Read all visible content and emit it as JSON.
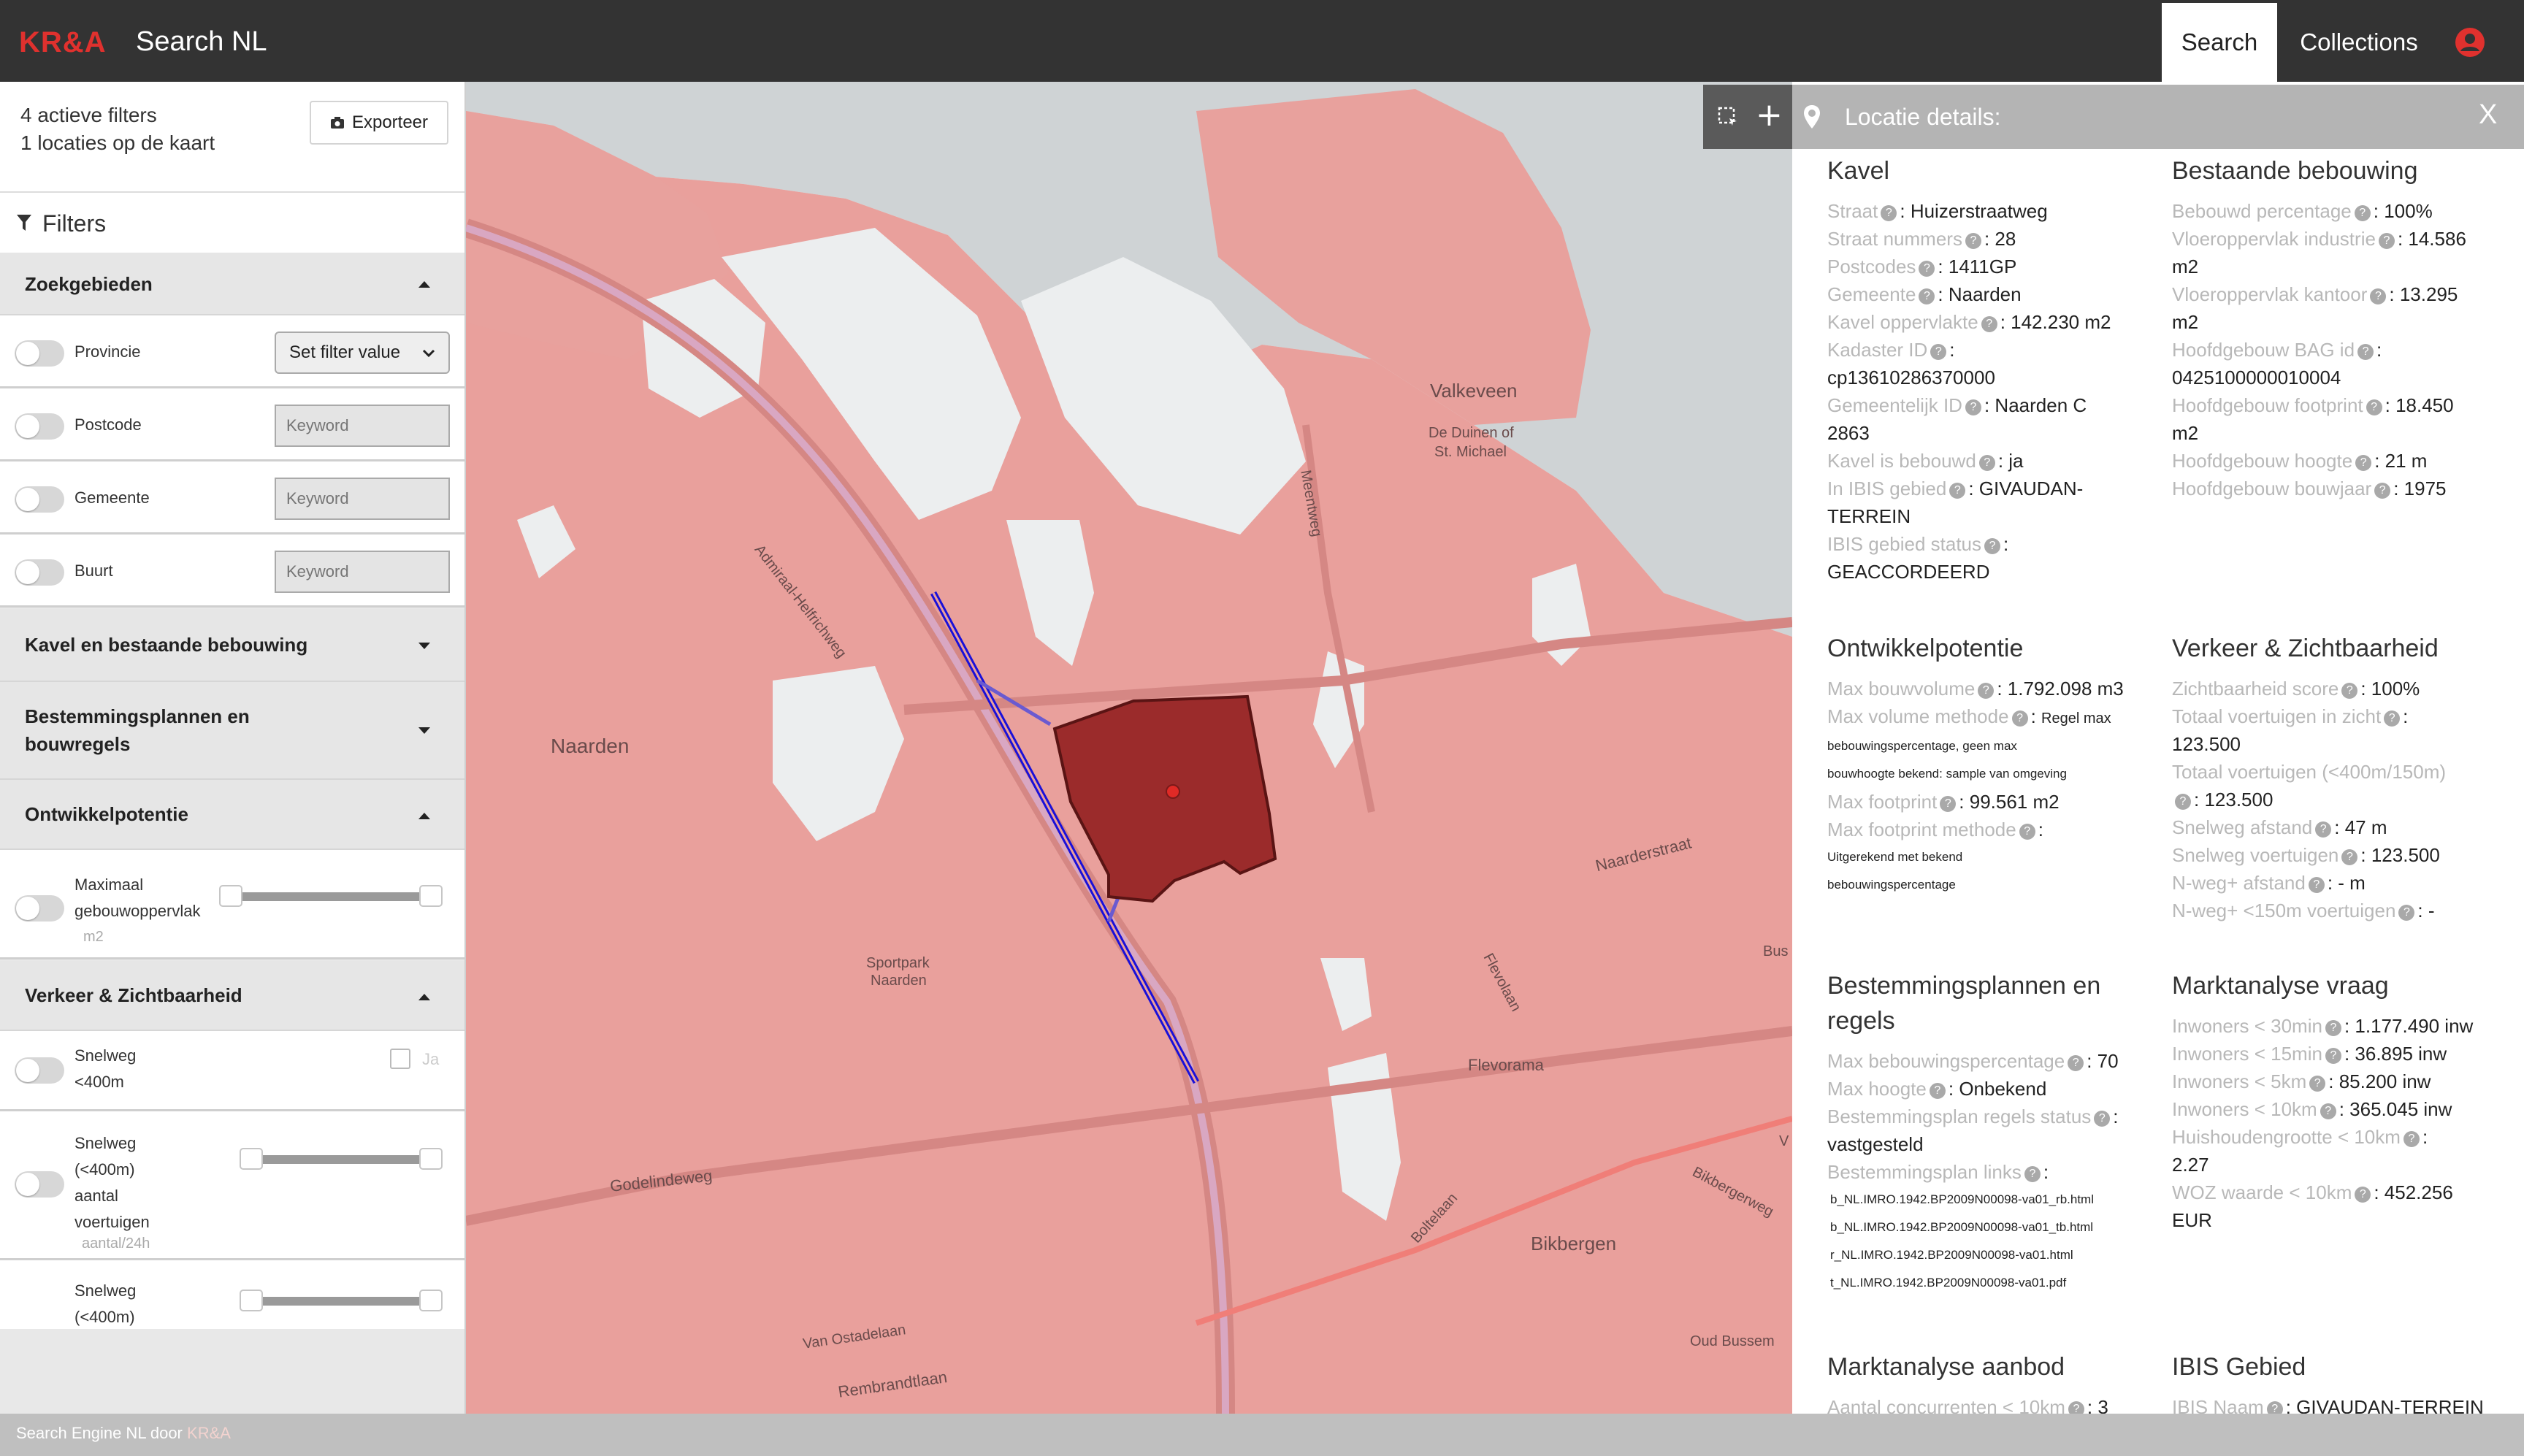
{
  "header": {
    "logo": "KR&A",
    "title": "Search NL",
    "nav": {
      "search": "Search",
      "collections": "Collections"
    }
  },
  "sidebar": {
    "active_filters": "4 actieve filters",
    "locations_on_map": "1 locaties op de kaart",
    "export_label": "Exporteer",
    "filters_title": "Filters",
    "sections": {
      "zoekgebieden": "Zoekgebieden",
      "kavel": "Kavel en bestaande bebouwing",
      "bestemming": "Bestemmingsplannen en bouwregels",
      "ontwikkel": "Ontwikkelpotentie",
      "verkeer": "Verkeer & Zichtbaarheid"
    },
    "zoek": {
      "provincie": "Provincie",
      "provincie_select": "Set filter value",
      "postcode": "Postcode",
      "gemeente": "Gemeente",
      "buurt": "Buurt",
      "keyword_placeholder": "Keyword"
    },
    "ontwikkel": {
      "label": "Maximaal gebouwoppervlak",
      "unit": "m2",
      "range": [
        0,
        1
      ]
    },
    "verkeer": {
      "snelweg": "Snelweg <400m",
      "checkbox_label": "Ja",
      "snelweg_voertuigen": "Snelweg (<400m) aantal voertuigen",
      "voertuigen_unit": "aantal/24h",
      "snelweg_partial": "Snelweg (<400m)"
    }
  },
  "map": {
    "labels": {
      "valkeveen": "Valkeveen",
      "duinen": "De Duinen of",
      "duinen2": "St. Michael",
      "naarden": "Naarden",
      "admiraal": "Admiraal-Helfrichweg",
      "meentweg": "Meentweg",
      "naarderstraat": "Naarderstraat",
      "sportpark": "Sportpark",
      "sportpark2": "Naarden",
      "flevolaan": "Flevolaan",
      "flevorama": "Flevorama",
      "godelindeweg": "Godelindeweg",
      "bikbergen": "Bikbergen",
      "bikbergerweg": "Bikbergerweg",
      "boltelaan": "Boltelaan",
      "van_ostadelaan": "Van Ostadelaan",
      "rembrandtlaan": "Rembrandtlaan",
      "oud_bussem": "Oud Bussem",
      "bus": "Bus",
      "v": "V"
    }
  },
  "details": {
    "title": "Locatie details:",
    "close": "X",
    "kavel": {
      "heading": "Kavel",
      "straat_k": "Straat",
      "straat_v": ": Huizerstraatweg",
      "nummers_k": "Straat nummers",
      "nummers_v": ": 28",
      "postcodes_k": "Postcodes",
      "postcodes_v": ": 1411GP",
      "gemeente_k": "Gemeente",
      "gemeente_v": ": Naarden",
      "opp_k": "Kavel oppervlakte",
      "opp_v": ": 142.230 m2",
      "kadaster_k": "Kadaster ID",
      "kadaster_v": ":",
      "kadaster_v2": "cp13610286370000",
      "gemid_k": "Gemeentelijk ID",
      "gemid_v": ": Naarden C",
      "gemid_v2": "2863",
      "bebouwd_k": "Kavel is bebouwd",
      "bebouwd_v": ": ja",
      "ibis_k": "In IBIS gebied",
      "ibis_v": ": GIVAUDAN-",
      "ibis_v2": "TERREIN",
      "status_k": "IBIS gebied status",
      "status_v": ":",
      "status_v2": "GEACCORDEERD"
    },
    "bebouwing": {
      "heading": "Bestaande bebouwing",
      "pct_k": "Bebouwd percentage",
      "pct_v": ": 100%",
      "ind_k": "Vloeroppervlak industrie",
      "ind_v": ": 14.586",
      "ind_v2": "m2",
      "kant_k": "Vloeroppervlak kantoor",
      "kant_v": ": 13.295",
      "kant_v2": "m2",
      "bag_k": "Hoofdgebouw BAG id",
      "bag_v": ":",
      "bag_v2": "0425100000010004",
      "fp_k": "Hoofdgebouw footprint",
      "fp_v": ": 18.450",
      "fp_v2": "m2",
      "hoogte_k": "Hoofdgebouw hoogte",
      "hoogte_v": ": 21 m",
      "jaar_k": "Hoofdgebouw bouwjaar",
      "jaar_v": ": 1975"
    },
    "ontwikkel": {
      "heading": "Ontwikkelpotentie",
      "vol_k": "Max bouwvolume",
      "vol_v": ": 1.792.098 m3",
      "meth_k": "Max volume methode",
      "meth_v": ":",
      "meth_v1": "Regel max",
      "meth_v2": "bebouwingspercentage, geen max",
      "meth_v3": "bouwhoogte bekend: sample van omgeving",
      "fp_k": "Max footprint",
      "fp_v": ": 99.561 m2",
      "fpm_k": "Max footprint methode",
      "fpm_v": ":",
      "fpm_v2": "Uitgerekend met bekend",
      "fpm_v3": "bebouwingspercentage"
    },
    "verkeer": {
      "heading": "Verkeer & Zichtbaarheid",
      "score_k": "Zichtbaarheid score",
      "score_v": ": 100%",
      "zicht_k": "Totaal voertuigen in zicht",
      "zicht_v": ":",
      "zicht_v2": "123.500",
      "tot_k": "Totaal voertuigen (<400m/150m)",
      "tot_v": ": 123.500",
      "afst_k": "Snelweg afstand",
      "afst_v": ": 47 m",
      "sv_k": "Snelweg voertuigen",
      "sv_v": ": 123.500",
      "nweg_k": "N-weg+ afstand",
      "nweg_v": ": - m",
      "nv_k": "N-weg+ <150m voertuigen",
      "nv_v": ": -"
    },
    "bestemming": {
      "heading": "Bestemmingsplannen en regels",
      "pct_k": "Max bebouwingspercentage",
      "pct_v": ": 70",
      "hoogte_k": "Max hoogte",
      "hoogte_v": ": Onbekend",
      "status_k": "Bestemmingsplan regels status",
      "status_v": ":",
      "status_v2": "vastgesteld",
      "links_k": "Bestemmingsplan links",
      "links_v": ":",
      "links": [
        "b_NL.IMRO.1942.BP2009N00098-va01_rb.html",
        "b_NL.IMRO.1942.BP2009N00098-va01_tb.html",
        "r_NL.IMRO.1942.BP2009N00098-va01.html",
        "t_NL.IMRO.1942.BP2009N00098-va01.pdf"
      ]
    },
    "vraag": {
      "heading": "Marktanalyse vraag",
      "i30_k": "Inwoners < 30min",
      "i30_v": ": 1.177.490 inw",
      "i15_k": "Inwoners < 15min",
      "i15_v": ": 36.895 inw",
      "i5_k": "Inwoners < 5km",
      "i5_v": ": 85.200 inw",
      "i10_k": "Inwoners < 10km",
      "i10_v": ": 365.045 inw",
      "hh_k": "Huishoudengrootte < 10km",
      "hh_v": ":",
      "hh_v2": "2.27",
      "woz_k": "WOZ waarde < 10km",
      "woz_v": ": 452.256",
      "woz_v2": "EUR"
    },
    "aanbod": {
      "heading": "Marktanalyse aanbod",
      "conc_k": "Aantal concurrenten < 10km",
      "conc_v": ": 3"
    },
    "ibis": {
      "heading": "IBIS Gebied",
      "naam_k": "IBIS Naam",
      "naam_v": ": GIVAUDAN-TERREIN"
    }
  },
  "footer": {
    "text": "Search Engine NL door",
    "brand": "KR&A"
  },
  "colors": {
    "brand": "#e0312e",
    "map_overlay": "#e9a09c",
    "selected_parcel": "#9b2b2b",
    "highway": "#1a10d8"
  }
}
